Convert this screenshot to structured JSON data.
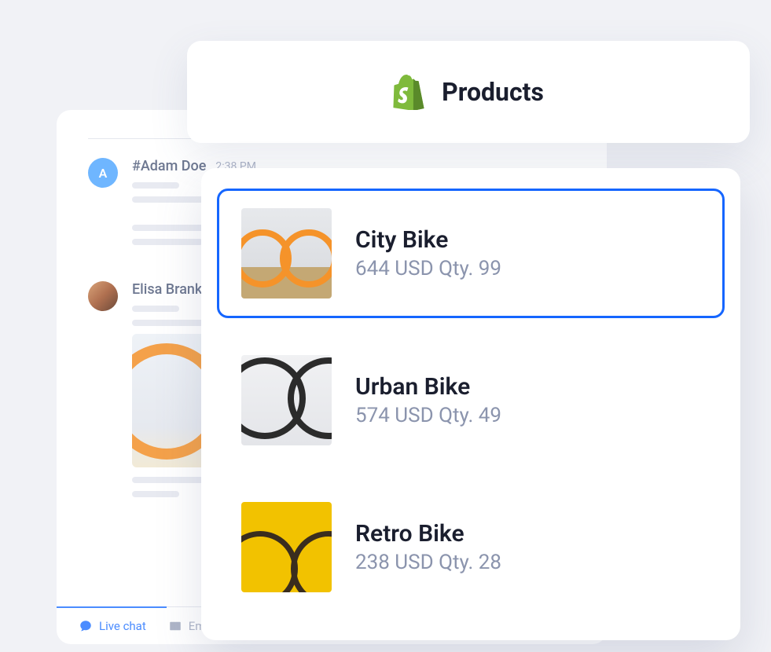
{
  "header": {
    "title": "Products"
  },
  "chat": {
    "messages": [
      {
        "name": "#Adam Doe",
        "time": "2:38 PM",
        "avatar_initial": "A"
      },
      {
        "name": "Elisa Branky",
        "time": "",
        "avatar_initial": ""
      }
    ],
    "tabs": {
      "live_chat": "Live chat",
      "email": "Email"
    }
  },
  "products": [
    {
      "name": "City Bike",
      "price": "644",
      "currency": "USD",
      "qty_label": "Qty.",
      "qty": "99",
      "selected": true
    },
    {
      "name": "Urban Bike",
      "price": "574",
      "currency": "USD",
      "qty_label": "Qty.",
      "qty": "49",
      "selected": false
    },
    {
      "name": "Retro Bike",
      "price": "238",
      "currency": "USD",
      "qty_label": "Qty.",
      "qty": "28",
      "selected": false
    }
  ]
}
